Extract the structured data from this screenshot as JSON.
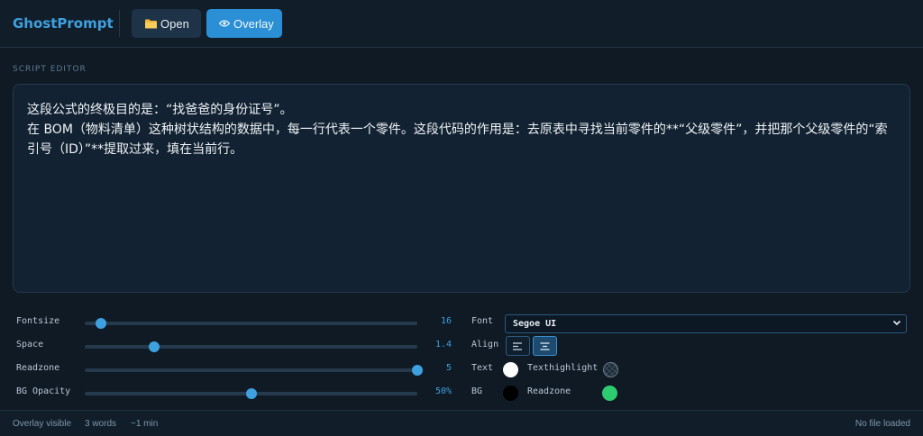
{
  "app": {
    "brand": "GhostPrompt"
  },
  "toolbar": {
    "open_label": "Open",
    "overlay_label": "Overlay"
  },
  "editor": {
    "section_label": "SCRIPT EDITOR",
    "lines": [
      "这段公式的终极目的是：“找爸爸的身份证号”。",
      "在 BOM（物料清单）这种树状结构的数据中，每一行代表一个零件。这段代码的作用是：去原表中寻找当前零件的**“父级零件”，并把那个父级零件的“索引号（ID）”**提取过来，填在当前行。"
    ]
  },
  "controls": {
    "fontsize": {
      "label": "Fontsize",
      "value": "16",
      "fraction": 0.05
    },
    "space": {
      "label": "Space",
      "value": "1.4",
      "fraction": 0.21
    },
    "readzone": {
      "label": "Readzone",
      "value": "5",
      "fraction": 1.0
    },
    "bg_opacity": {
      "label": "BG Opacity",
      "value": "50%",
      "fraction": 0.5
    },
    "font": {
      "label": "Font",
      "selected": "Segoe UI"
    },
    "align": {
      "label": "Align",
      "options": [
        "left",
        "center"
      ],
      "selected": "center"
    },
    "text_color": {
      "label": "Text",
      "color": "#ffffff"
    },
    "texthighlight_color": {
      "label": "Texthighlight",
      "color": "transparent"
    },
    "bg_color": {
      "label": "BG",
      "color": "#000000"
    },
    "readzone_color": {
      "label": "Readzone",
      "color": "#2ecc71"
    }
  },
  "status": {
    "overlay": "Overlay visible",
    "words": "3 words",
    "time": "~1 min",
    "file": "No file loaded"
  },
  "colors": {
    "accent": "#3fa0e0",
    "background": "#0f1a24"
  }
}
